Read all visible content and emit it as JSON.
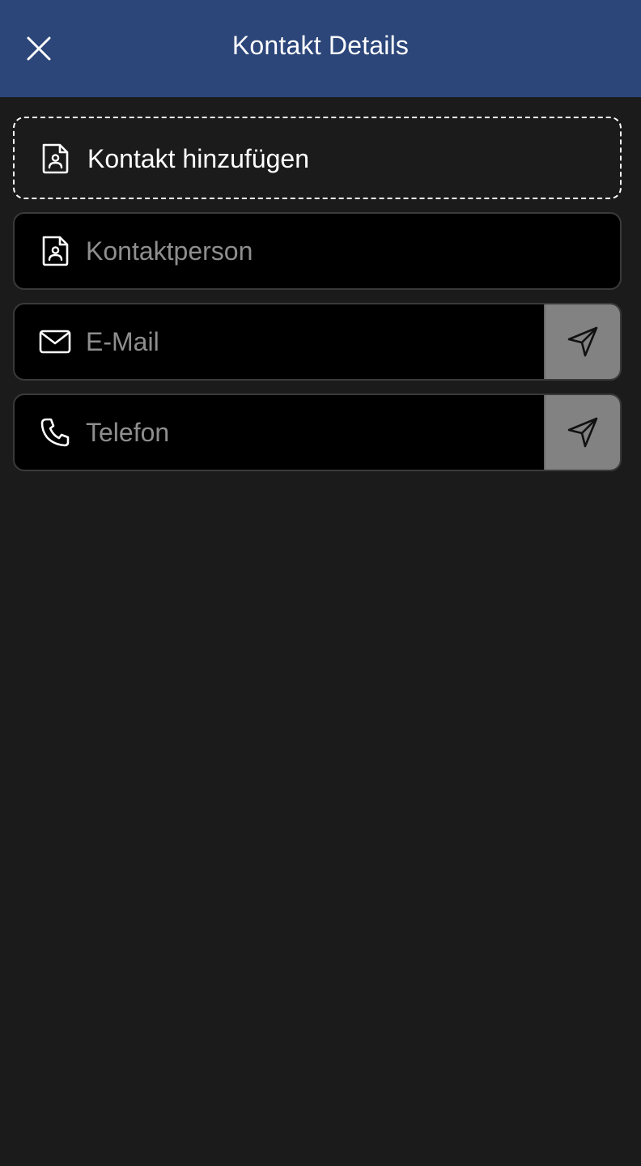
{
  "header": {
    "title": "Kontakt Details",
    "close_icon": "close-icon"
  },
  "add_contact": {
    "label": "Kontakt hinzufügen",
    "icon": "contact-card-icon"
  },
  "fields": {
    "person": {
      "placeholder": "Kontaktperson",
      "value": "",
      "icon": "contact-card-icon"
    },
    "email": {
      "placeholder": "E-Mail",
      "value": "",
      "icon": "mail-icon",
      "action_icon": "send-icon"
    },
    "phone": {
      "placeholder": "Telefon",
      "value": "",
      "icon": "phone-icon",
      "action_icon": "send-icon"
    }
  },
  "colors": {
    "header_bg": "#2c467a",
    "page_bg": "#1b1b1b",
    "field_bg": "#000000",
    "send_button_bg": "#828282",
    "placeholder": "#8e8e8e",
    "text": "#ffffff"
  }
}
